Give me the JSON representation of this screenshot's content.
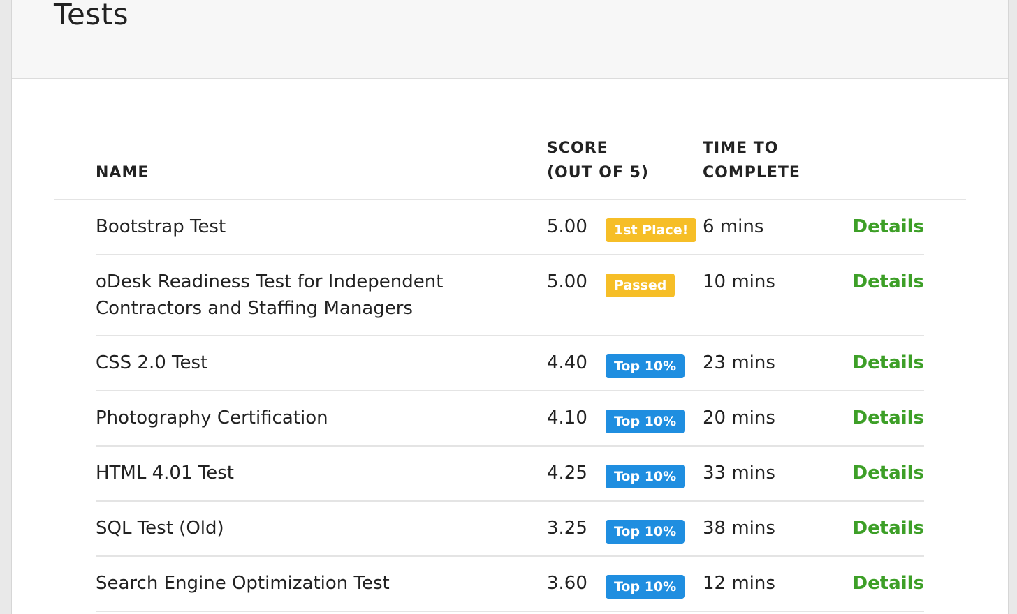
{
  "page": {
    "title": "Tests"
  },
  "table": {
    "headers": {
      "name": "NAME",
      "score_line1": "SCORE",
      "score_line2": "(OUT OF 5)",
      "time_line1": "TIME TO",
      "time_line2": "COMPLETE"
    },
    "details_label": "Details",
    "rows": [
      {
        "name": "Bootstrap Test",
        "score": "5.00",
        "badge": "1st Place!",
        "badge_color": "#f6be27",
        "time": "6 mins"
      },
      {
        "name": "oDesk Readiness Test for Independent Contractors and Staffing Managers",
        "score": "5.00",
        "badge": "Passed",
        "badge_color": "#f6be27",
        "time": "10 mins"
      },
      {
        "name": "CSS 2.0 Test",
        "score": "4.40",
        "badge": "Top 10%",
        "badge_color": "#1f8ee0",
        "time": "23 mins"
      },
      {
        "name": "Photography Certification",
        "score": "4.10",
        "badge": "Top 10%",
        "badge_color": "#1f8ee0",
        "time": "20 mins"
      },
      {
        "name": "HTML 4.01 Test",
        "score": "4.25",
        "badge": "Top 10%",
        "badge_color": "#1f8ee0",
        "time": "33 mins"
      },
      {
        "name": "SQL Test (Old)",
        "score": "3.25",
        "badge": "Top 10%",
        "badge_color": "#1f8ee0",
        "time": "38 mins"
      },
      {
        "name": "Search Engine Optimization Test",
        "score": "3.60",
        "badge": "Top 10%",
        "badge_color": "#1f8ee0",
        "time": "12 mins"
      }
    ]
  },
  "colors": {
    "link_green": "#3d9f27",
    "badge_gold": "#f6be27",
    "badge_blue": "#1f8ee0"
  }
}
